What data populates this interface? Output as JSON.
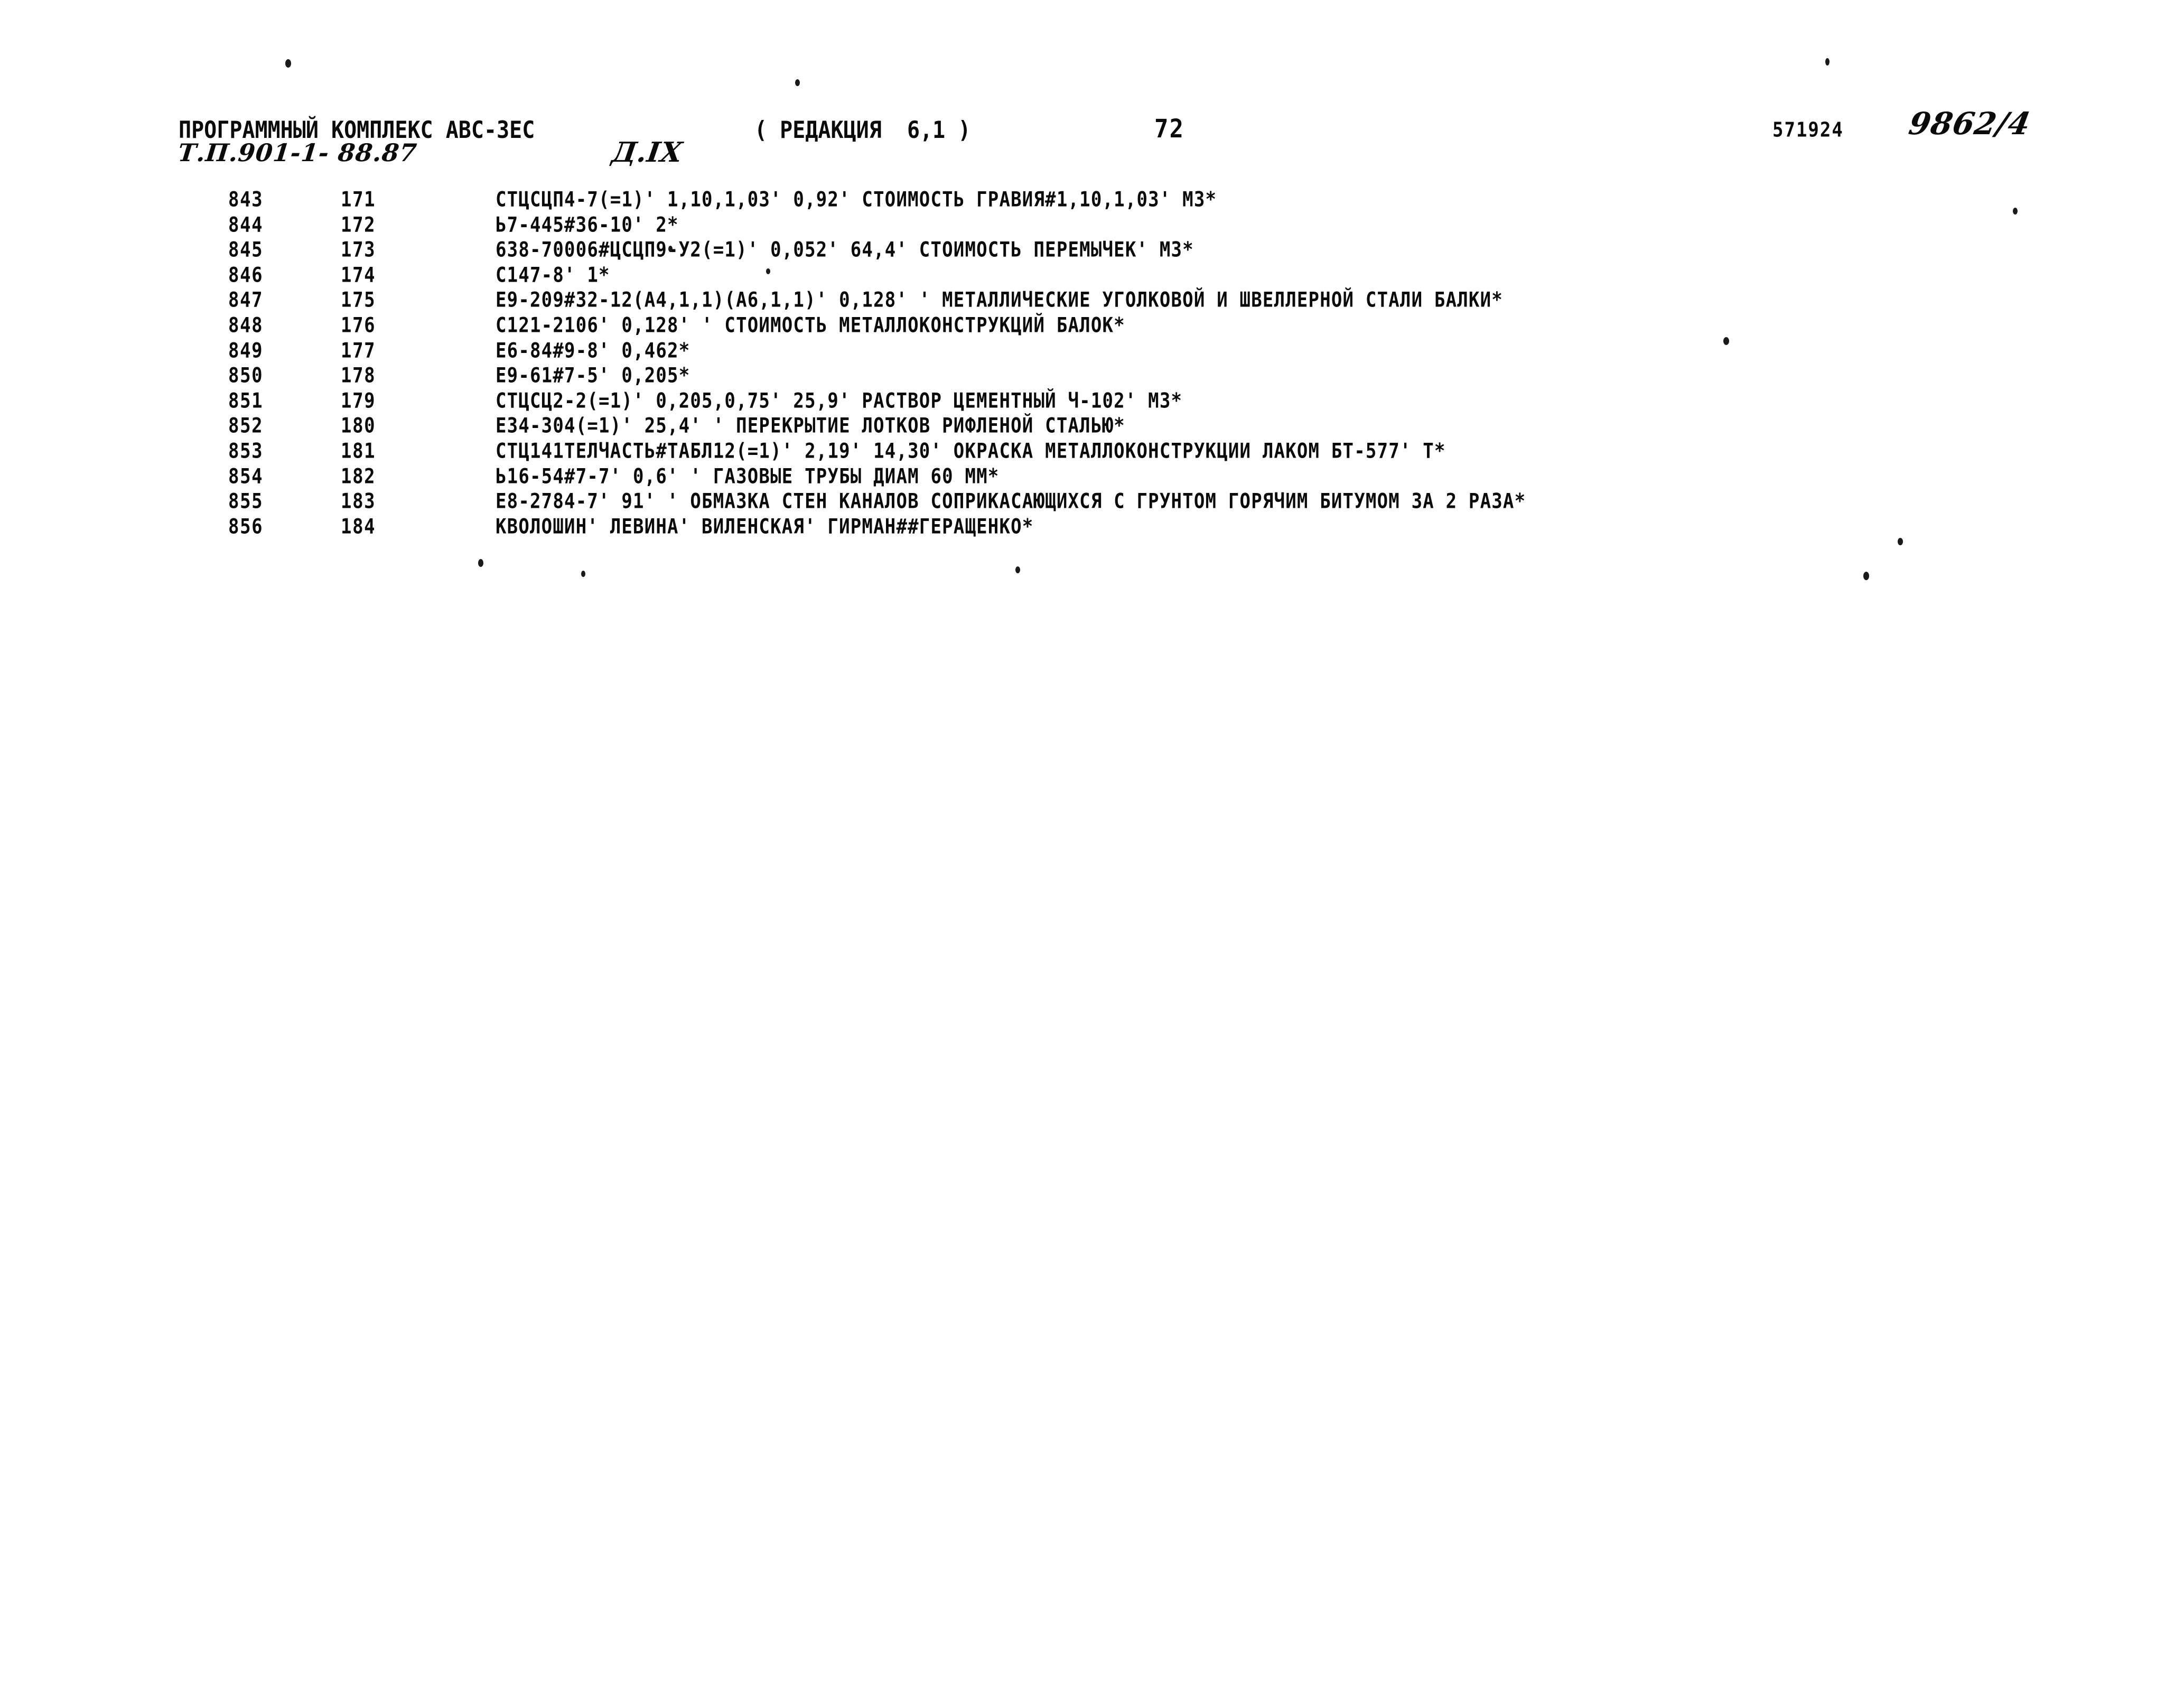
{
  "document": {
    "header": {
      "program_title": "ПРОГРАММНЫЙ КОМПЛЕКС АВС-3ЕС",
      "revision": "( РЕДАКЦИЯ  6,1 )",
      "page_number": "72",
      "doc_code": "571924",
      "handwritten_tp": "Т.П.901-1- 88.87",
      "handwritten_section": "Д.IX",
      "handwritten_number": "9862/4"
    },
    "listing": {
      "rows": [
        {
          "seq": "843",
          "num": "171",
          "text": "СТЦСЦП4-7(=1)' 1,10,1,03' 0,92' СТОИМОСТЬ ГРАВИЯ#1,10,1,03' М3*"
        },
        {
          "seq": "844",
          "num": "172",
          "text": "Ь7-445#36-10' 2*"
        },
        {
          "seq": "845",
          "num": "173",
          "text": "638-70006#ЦСЦП9-У2(=1)' 0,052' 64,4' СТОИМОСТЬ ПЕРЕМЫЧЕК' М3*"
        },
        {
          "seq": "846",
          "num": "174",
          "text": "С147-8' 1*"
        },
        {
          "seq": "847",
          "num": "175",
          "text": "Е9-209#32-12(А4,1,1)(А6,1,1)' 0,128' ' МЕТАЛЛИЧЕСКИЕ УГОЛКОВОЙ И ШВЕЛЛЕРНОЙ СТАЛИ БАЛКИ*"
        },
        {
          "seq": "848",
          "num": "176",
          "text": "С121-2106' 0,128' ' СТОИМОСТЬ МЕТАЛЛОКОНСТРУКЦИЙ БАЛОК*"
        },
        {
          "seq": "849",
          "num": "177",
          "text": "Е6-84#9-8' 0,462*"
        },
        {
          "seq": "850",
          "num": "178",
          "text": "Е9-61#7-5' 0,205*"
        },
        {
          "seq": "851",
          "num": "179",
          "text": "СТЦСЦ2-2(=1)' 0,205,0,75' 25,9' РАСТВОР ЦЕМЕНТНЫЙ Ч-102' М3*"
        },
        {
          "seq": "852",
          "num": "180",
          "text": "Е34-304(=1)' 25,4' ' ПЕРЕКРЫТИЕ ЛОТКОВ РИФЛЕНОЙ СТАЛЬЮ*"
        },
        {
          "seq": "853",
          "num": "181",
          "text": "СТЦ141ТЕЛЧАСТЬ#ТАБЛ12(=1)' 2,19' 14,30' ОКРАСКА МЕТАЛЛОКОНСТРУКЦИИ ЛАКОМ БТ-577' Т*"
        },
        {
          "seq": "854",
          "num": "182",
          "text": "Ь16-54#7-7' 0,6' ' ГАЗОВЫЕ ТРУБЫ ДИАМ 60 ММ*"
        },
        {
          "seq": "855",
          "num": "183",
          "text": "Е8-2784-7' 91' ' ОБМАЗКА СТЕН КАНАЛОВ СОПРИКАСАЮЩИХСЯ С ГРУНТОМ ГОРЯЧИМ БИТУМОМ ЗА 2 РАЗА*"
        },
        {
          "seq": "856",
          "num": "184",
          "text": "КВОЛОШИН' ЛЕВИНА' ВИЛЕНСКАЯ' ГИРМАН##ГЕРАЩЕНКО*"
        }
      ]
    }
  }
}
